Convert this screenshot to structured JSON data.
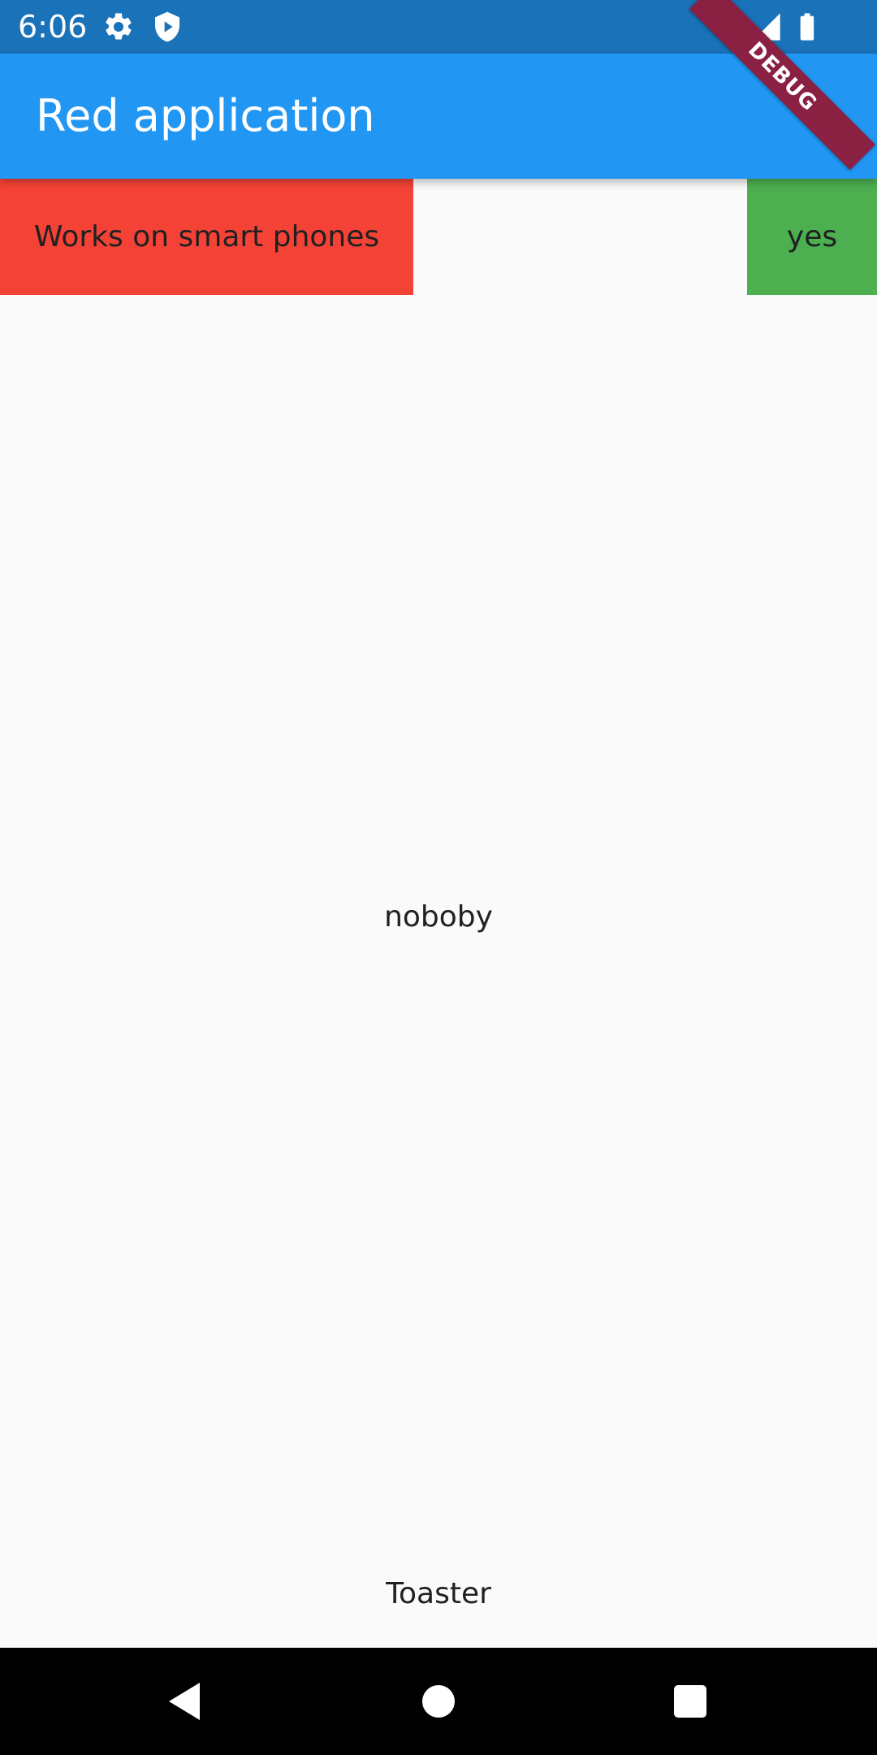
{
  "status_bar": {
    "time": "6:06",
    "icons": [
      "gear-icon",
      "shield-play-icon",
      "wifi-icon",
      "cell-signal-icon",
      "battery-icon"
    ]
  },
  "app_bar": {
    "title": "Red application",
    "debug_banner": "DEBUG"
  },
  "content": {
    "red_box_label": "Works on smart phones",
    "green_box_label": "yes",
    "center_text": "noboby",
    "toaster_label": "Toaster"
  },
  "nav_bar": {
    "icons": [
      "back-icon",
      "home-icon",
      "recents-icon"
    ]
  },
  "colors": {
    "status_bar": "#1a72b9",
    "app_bar": "#2196f3",
    "red_box": "#f44336",
    "green_box": "#4caf50",
    "debug_banner": "#8a2142",
    "background": "#fafafa"
  }
}
